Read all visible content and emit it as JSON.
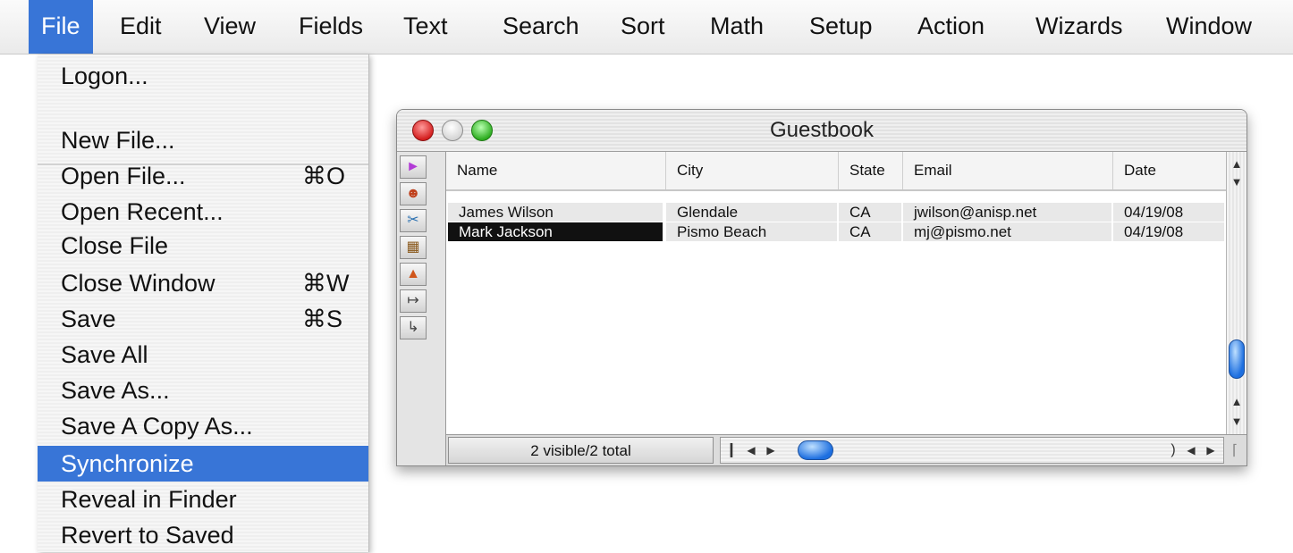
{
  "menubar": {
    "items": [
      {
        "label": "File",
        "active": true
      },
      {
        "label": "Edit"
      },
      {
        "label": "View"
      },
      {
        "label": "Fields"
      },
      {
        "label": "Text"
      },
      {
        "label": "Search"
      },
      {
        "label": "Sort"
      },
      {
        "label": "Math"
      },
      {
        "label": "Setup"
      },
      {
        "label": "Action"
      },
      {
        "label": "Wizards"
      },
      {
        "label": "Window"
      }
    ]
  },
  "file_menu": {
    "items": [
      {
        "label": "Logon...",
        "shortcut": ""
      },
      {
        "label": "New File...",
        "shortcut": ""
      },
      {
        "label": "Open File...",
        "shortcut": "⌘O"
      },
      {
        "label": "Open Recent...",
        "shortcut": ""
      },
      {
        "label": "Close File",
        "shortcut": ""
      },
      {
        "label": "Close Window",
        "shortcut": "⌘W"
      },
      {
        "label": "Save",
        "shortcut": "⌘S"
      },
      {
        "label": "Save All",
        "shortcut": ""
      },
      {
        "label": "Save As...",
        "shortcut": ""
      },
      {
        "label": "Save A Copy As...",
        "shortcut": ""
      },
      {
        "label": "Synchronize",
        "shortcut": "",
        "highlighted": true
      },
      {
        "label": "Reveal in Finder",
        "shortcut": ""
      },
      {
        "label": "Revert to Saved",
        "shortcut": ""
      }
    ]
  },
  "window": {
    "title": "Guestbook",
    "columns": [
      "Name",
      "City",
      "State",
      "Email",
      "Date"
    ],
    "rows": [
      {
        "Name": "James Wilson",
        "City": "Glendale",
        "State": "CA",
        "Email": "jwilson@anisp.net",
        "Date": "04/19/08"
      },
      {
        "Name": "Mark Jackson",
        "City": "Pismo Beach",
        "State": "CA",
        "Email": "mj@pismo.net",
        "Date": "04/19/08"
      }
    ],
    "status": "2 visible/2 total",
    "tools": [
      "pointer-tool-icon",
      "people-tool-icon",
      "scissors-tool-icon",
      "form-tool-icon",
      "stamp-tool-icon",
      "tab-right-tool-icon",
      "return-tool-icon"
    ]
  },
  "colors": {
    "highlight": "#3875d7",
    "selected_cell": "#111111"
  }
}
